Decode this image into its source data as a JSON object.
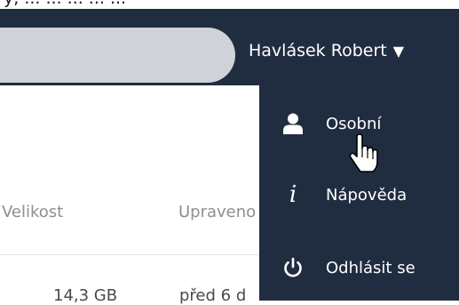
{
  "search": {
    "placeholder": "",
    "value": ""
  },
  "header": {
    "user_name": "Havlásek Robert",
    "caret": "▼"
  },
  "dropdown": {
    "items": [
      {
        "label": "Osobní",
        "icon": "user-icon"
      },
      {
        "label": "Nápověda",
        "icon": "info-icon"
      },
      {
        "label": "Odhlásit se",
        "icon": "power-icon"
      }
    ]
  },
  "table": {
    "columns": [
      "Velikost",
      "Upraveno"
    ],
    "rows": [
      {
        "size": "14,3 GB",
        "modified": "před 6 d"
      }
    ]
  },
  "icons": {
    "info_glyph": "i"
  },
  "colors": {
    "navbar": "#202d41",
    "dropdown": "#202d41",
    "search": "#cfd3d8"
  }
}
